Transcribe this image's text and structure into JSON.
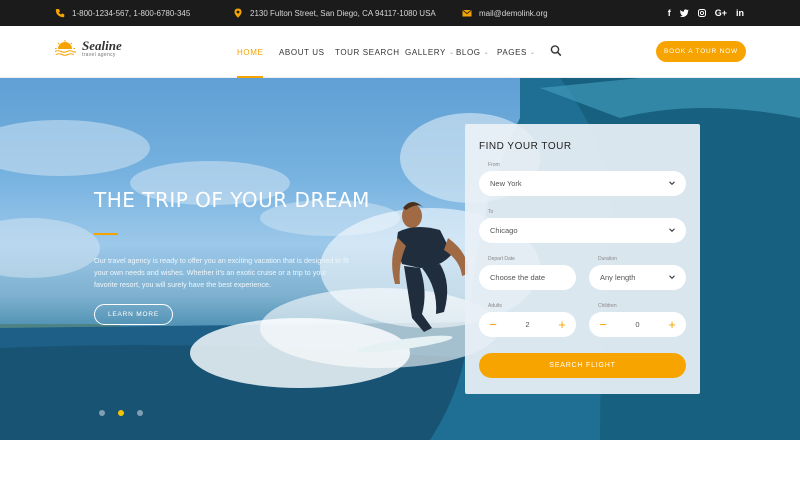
{
  "topbar": {
    "phone": "1-800-1234-567, 1-800-6780-345",
    "address": "2130 Fulton Street, San Diego, CA 94117-1080 USA",
    "email": "mail@demolink.org",
    "social": [
      "f",
      "t",
      "ig",
      "G+",
      "in"
    ]
  },
  "header": {
    "logo_name": "Sealine",
    "logo_sub": "travel agency",
    "nav": [
      {
        "label": "HOME",
        "active": true
      },
      {
        "label": "ABOUT US"
      },
      {
        "label": "TOUR SEARCH"
      },
      {
        "label": "GALLERY",
        "dropdown": true
      },
      {
        "label": "BLOG",
        "dropdown": true
      },
      {
        "label": "PAGES",
        "dropdown": true
      }
    ],
    "book_label": "BOOK A TOUR NOW"
  },
  "hero": {
    "title": "THE TRIP OF YOUR DREAM",
    "text": "Our travel agency is ready to offer you an exciting vacation that is designed to fit your own needs and wishes. Whether it's an exotic cruise or a trip to your favorite resort, you will surely have the best experience.",
    "learn_more": "LEARN MORE",
    "slides": 3,
    "active_slide": 2
  },
  "tour_form": {
    "title": "FIND YOUR TOUR",
    "from_label": "From",
    "from_value": "New York",
    "to_label": "To",
    "to_value": "Chicago",
    "depart_label": "Depart Date",
    "depart_value": "Choose the date",
    "duration_label": "Duration",
    "duration_value": "Any length",
    "adults_label": "Adults",
    "adults_value": "2",
    "children_label": "Children",
    "children_value": "0",
    "submit_label": "SEARCH FLIGHT"
  },
  "colors": {
    "accent": "#f8a400",
    "topbar": "#1b1b1b"
  }
}
